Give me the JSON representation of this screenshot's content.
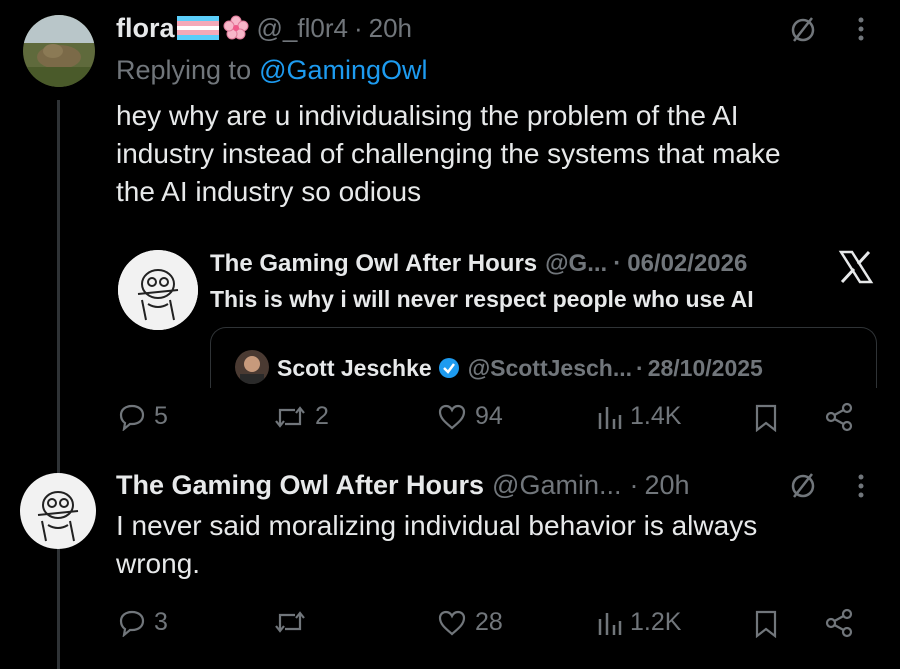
{
  "reply": {
    "display_name": "flora",
    "handle": "@_fl0r4",
    "separator": "·",
    "time": "20h",
    "replying_prefix": "Replying to",
    "replying_to": "@GamingOwl",
    "text_lines": [
      "hey why are u individualising the problem of the AI",
      "industry instead of challenging the systems that make",
      "the AI industry so odious"
    ],
    "quote": {
      "display_name": "The Gaming Owl After Hours",
      "handle": "@G...",
      "date": "06/02/2026",
      "text": "This is why i will never respect people who use AI",
      "nested": {
        "display_name": "Scott Jeschke",
        "handle": "@ScottJesch...",
        "date": "28/10/2025"
      }
    },
    "actions": {
      "replies": "5",
      "reposts": "2",
      "likes": "94",
      "views": "1.4K"
    }
  },
  "response": {
    "display_name": "The Gaming Owl After Hours",
    "handle": "@Gamin...",
    "separator": "·",
    "time": "20h",
    "text_lines": [
      "I never said moralizing individual behavior is always",
      "wrong."
    ],
    "actions": {
      "replies": "3",
      "reposts": "",
      "likes": "28",
      "views": "1.2K"
    }
  },
  "colors": {
    "background": "#000000",
    "text": "#e7e9ea",
    "muted": "#71767b",
    "link": "#1d9bf0",
    "verified": "#1d9bf0"
  }
}
